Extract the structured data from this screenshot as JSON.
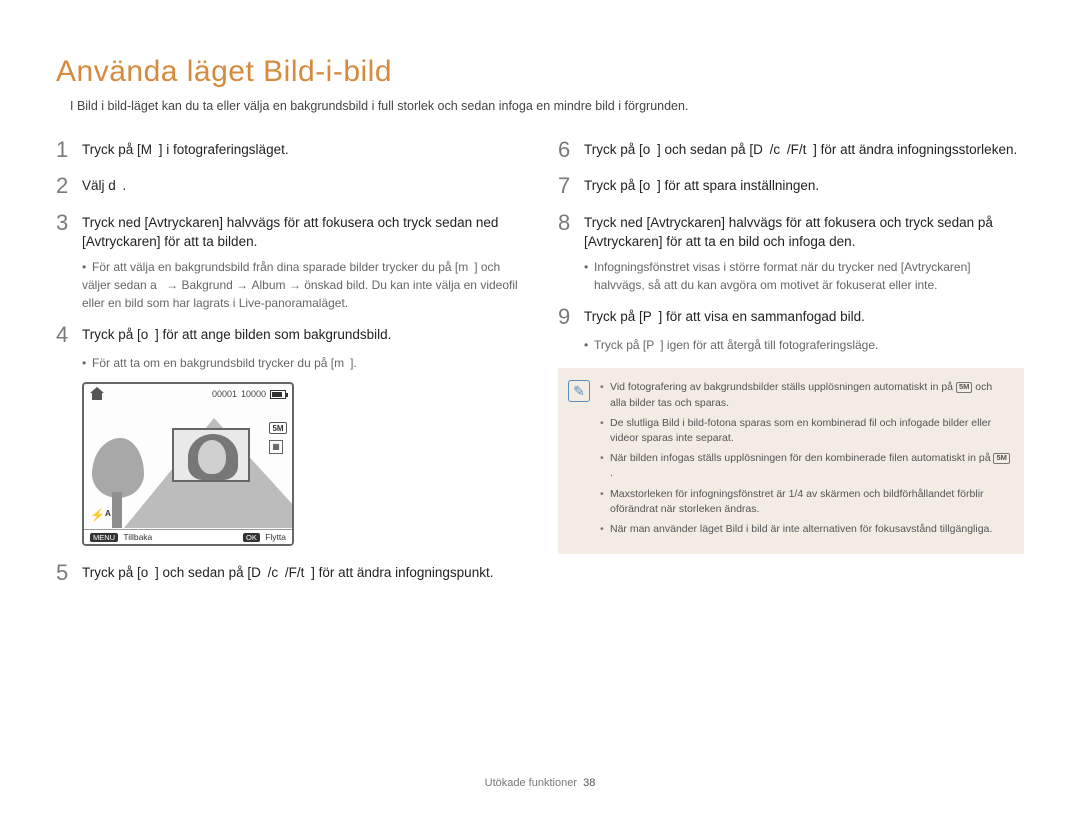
{
  "title": "Använda läget Bild-i-bild",
  "intro": "I Bild i bild-läget kan du ta eller välja en bakgrundsbild i full storlek och sedan infoga en mindre bild i förgrunden.",
  "left": {
    "s1": {
      "num": "1",
      "text": "Tryck på [M ] i fotograferingsläget."
    },
    "s2": {
      "num": "2",
      "text": "Välj d ."
    },
    "s3": {
      "num": "3",
      "text": "Tryck ned [Avtryckaren] halvvägs för att fokusera och tryck sedan ned [Avtryckaren] för att ta bilden.",
      "sub_a": "För att välja en bakgrundsbild från dina sparade bilder trycker du på [m ] och väljer sedan",
      "sub_b": "a ",
      "sub_c": "Bakgrund",
      "sub_d": "Album",
      "sub_e": "önskad bild. Du kan inte välja en videofil eller en bild som har lagrats i Live-panoramaläget."
    },
    "s4": {
      "num": "4",
      "text": "Tryck på [o ] för att ange bilden som bakgrundsbild.",
      "sub": "För att ta om en bakgrundsbild trycker du på [m ]."
    },
    "s5": {
      "num": "5",
      "text": "Tryck på [o ] och sedan på [D /c /F/t ] för att ändra infogningspunkt."
    }
  },
  "preview": {
    "counter": "00001",
    "shots": "10000",
    "res": "5M",
    "flash": "⚡ᴬ",
    "menu_chip": "MENU",
    "back_label": "Tillbaka",
    "ok_chip": "OK",
    "move_label": "Flytta"
  },
  "right": {
    "s6": {
      "num": "6",
      "text": "Tryck på [o ] och sedan på [D /c /F/t ] för att ändra infogningsstorleken."
    },
    "s7": {
      "num": "7",
      "text": "Tryck på [o ] för att spara inställningen."
    },
    "s8": {
      "num": "8",
      "text": "Tryck ned [Avtryckaren] halvvägs för att fokusera och tryck sedan på [Avtryckaren] för att ta en bild och infoga den.",
      "sub": "Infogningsfönstret visas i större format när du trycker ned [Avtryckaren] halvvägs, så att du kan avgöra om motivet är fokuserat eller inte."
    },
    "s9": {
      "num": "9",
      "text": "Tryck på [P ] för att visa en sammanfogad bild.",
      "sub": "Tryck på [P ] igen för att återgå till fotograferingsläge."
    }
  },
  "notes": {
    "n1a": "Vid fotografering av bakgrundsbilder ställs upplösningen automatiskt in på ",
    "n1b": " och alla bilder tas och sparas.",
    "n2": "De slutliga Bild i bild-fotona sparas som en kombinerad fil och infogade bilder eller videor sparas inte separat.",
    "n3a": "När bilden infogas ställs upplösningen för den kombinerade filen automatiskt in på ",
    "n3b": ".",
    "n4": "Maxstorleken för infogningsfönstret är 1/4 av skärmen och bildförhållandet förblir oförändrat när storleken ändras.",
    "n5": "När man använder läget Bild i bild är inte alternativen för fokusavstånd tillgängliga.",
    "res": "5M"
  },
  "footer": {
    "section": "Utökade funktioner",
    "page": "38"
  }
}
